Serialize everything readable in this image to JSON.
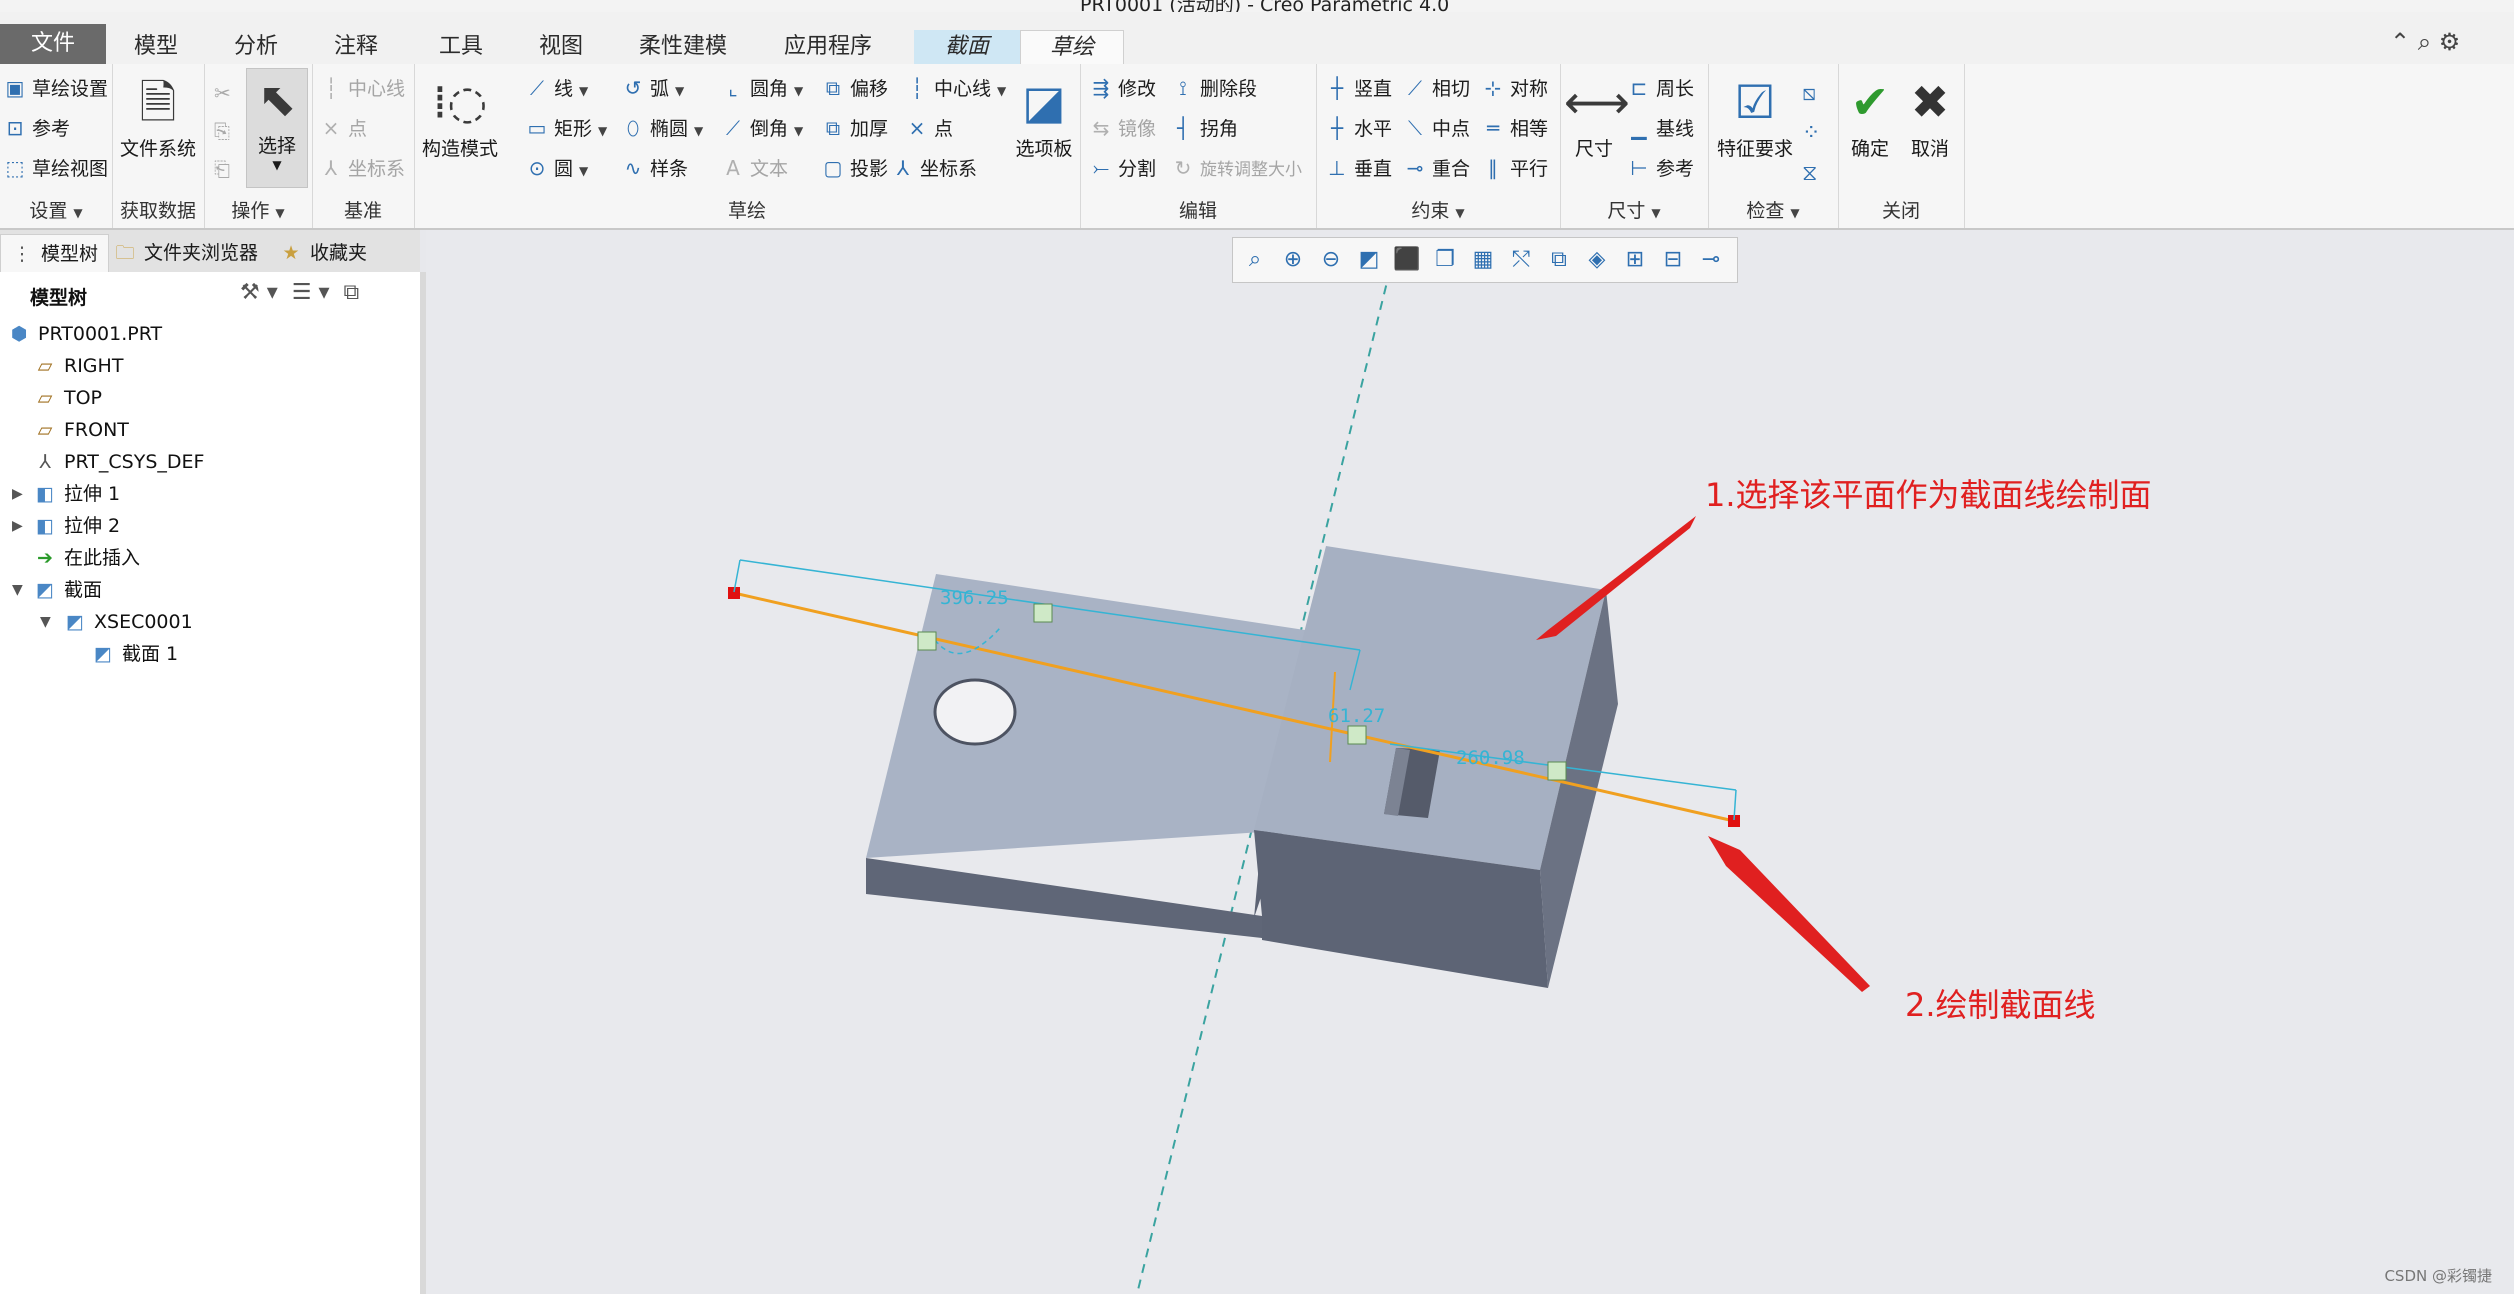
{
  "window": {
    "title": "PRT0001 (活动的) - Creo Parametric 4.0"
  },
  "tabs": [
    "文件",
    "模型",
    "分析",
    "注释",
    "工具",
    "视图",
    "柔性建模",
    "应用程序",
    "截面",
    "草绘"
  ],
  "ribbon": {
    "setup": {
      "items": [
        "草绘设置",
        "参考",
        "草绘视图"
      ],
      "label": "设置"
    },
    "get_data": {
      "button": "文件系统",
      "label": "获取数据"
    },
    "operations": {
      "select": "选择",
      "label": "操作"
    },
    "datum": {
      "items": [
        "中心线",
        "点",
        "坐标系"
      ],
      "label": "基准"
    },
    "sketch": {
      "construction": "构造模式",
      "col1": [
        "线",
        "矩形",
        "圆"
      ],
      "col2": [
        "弧",
        "椭圆",
        "样条"
      ],
      "col3": [
        "圆角",
        "倒角",
        "文本"
      ],
      "col4": [
        "偏移",
        "加厚",
        "投影"
      ],
      "col5": [
        "中心线",
        "点",
        "坐标系"
      ],
      "palette": "选项板",
      "label": "草绘"
    },
    "edit": {
      "col1": [
        "修改",
        "镜像",
        "分割"
      ],
      "col2": [
        "删除段",
        "拐角",
        "旋转调整大小"
      ],
      "label": "编辑"
    },
    "constrain": {
      "col1": [
        "竖直",
        "水平",
        "垂直"
      ],
      "col2": [
        "相切",
        "中点",
        "重合"
      ],
      "col3": [
        "对称",
        "相等",
        "平行"
      ],
      "label": "约束"
    },
    "dimension": {
      "big": "尺寸",
      "items": [
        "周长",
        "基线",
        "参考"
      ],
      "label": "尺寸"
    },
    "inspect": {
      "big": "特征要求",
      "label": "检查"
    },
    "close": {
      "ok": "确定",
      "cancel": "取消",
      "label": "关闭"
    }
  },
  "panel": {
    "tabs": [
      "模型树",
      "文件夹浏览器",
      "收藏夹"
    ],
    "header": "模型树",
    "tree": [
      "PRT0001.PRT",
      "RIGHT",
      "TOP",
      "FRONT",
      "PRT_CSYS_DEF",
      "拉伸 1",
      "拉伸 2",
      "在此插入",
      "截面",
      "XSEC0001",
      "截面 1"
    ]
  },
  "dimensions": {
    "d1": "396.25",
    "d2": "61.27",
    "d3": "260.98"
  },
  "annotations": {
    "note1": "1.选择该平面作为截面线绘制面",
    "note2": "2.绘制截面线"
  },
  "watermark": "CSDN @彩镯捷"
}
